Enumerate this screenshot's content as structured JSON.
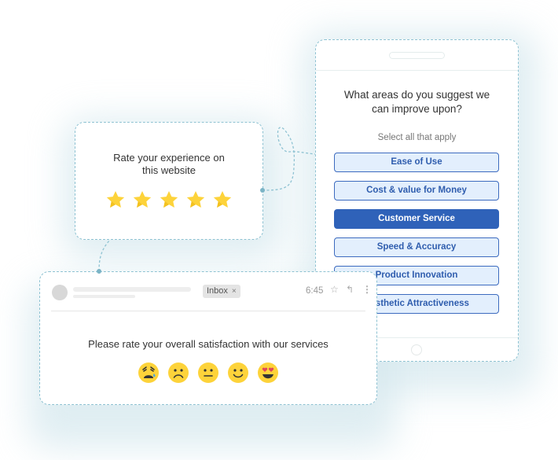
{
  "phone_survey": {
    "question": "What areas do you suggest we can improve upon?",
    "question_line1": "What areas do you suggest we",
    "question_line2": "can improve upon?",
    "instruction": "Select all that apply",
    "options": [
      {
        "label": "Ease of Use",
        "selected": false
      },
      {
        "label": "Cost & value for Money",
        "selected": false
      },
      {
        "label": "Customer Service",
        "selected": true
      },
      {
        "label": "Speed & Accuracy",
        "selected": false
      },
      {
        "label": "Product Innovation",
        "selected": false
      },
      {
        "label": "Aesthetic Attractiveness",
        "selected": false
      }
    ]
  },
  "star_rating": {
    "title_line1": "Rate your experience on",
    "title_line2": "this website",
    "stars_filled": 5,
    "stars_total": 5
  },
  "email": {
    "badge": "Inbox",
    "badge_close": "×",
    "time": "6:45",
    "icons": [
      "star-icon",
      "reply-icon",
      "more-vert-icon"
    ],
    "prompt": "Please rate your overall satisfaction with our services",
    "emoji_scale": [
      "crying",
      "frowning",
      "neutral",
      "smiling",
      "heart-eyes"
    ]
  },
  "colors": {
    "accent": "#2f62b9",
    "option_bg": "#e3effd",
    "star": "#fdd33a",
    "emoji": "#fdd33a",
    "dashed_border": "#8ec2d2"
  }
}
